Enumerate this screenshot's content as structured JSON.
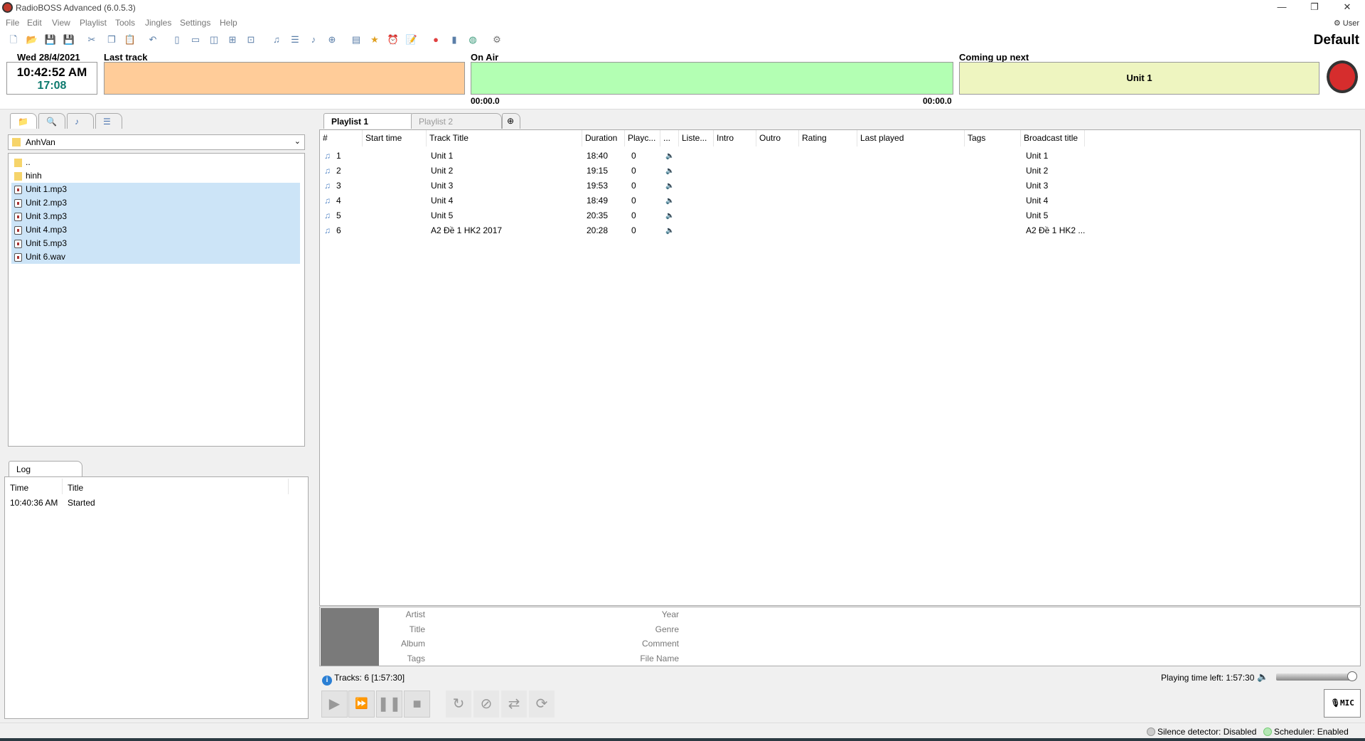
{
  "window": {
    "title": "RadioBOSS Advanced (6.0.5.3)",
    "user": "User",
    "profile": "Default"
  },
  "menu": [
    "File",
    "Edit",
    "View",
    "Playlist",
    "Tools",
    "Jingles",
    "Settings",
    "Help"
  ],
  "toolbar_icons": [
    "new-icon",
    "open-icon",
    "save-icon",
    "save-as-icon",
    "cut-icon",
    "copy-icon",
    "paste-icon",
    "undo-icon",
    "layout-left-icon",
    "layout-top-icon",
    "layout-two-icon",
    "layout-grid-icon",
    "layout-small-icon",
    "add-track-icon",
    "add-list-icon",
    "add-music-icon",
    "add-folder-icon",
    "report-icon",
    "jingle-icon",
    "scheduler-icon",
    "clipboard-icon",
    "record-icon",
    "stats-icon",
    "globe-icon",
    "settings-icon"
  ],
  "header": {
    "date": "Wed 28/4/2021",
    "time": "10:42:52 AM",
    "countdown": "17:08",
    "last_track_label": "Last track",
    "last_track": "",
    "on_air_label": "On Air",
    "on_air_elapsed": "00:00.0",
    "on_air_remaining": "00:00.0",
    "next_label": "Coming up next",
    "next_track": "Unit 1",
    "colors": {
      "last": "#ffcc99",
      "onair": "#b3ffb3",
      "next": "#eef5c0"
    }
  },
  "browser": {
    "folder": "AnhVan",
    "items": [
      {
        "name": "..",
        "type": "folder"
      },
      {
        "name": "hinh",
        "type": "folder"
      },
      {
        "name": "Unit 1.mp3",
        "type": "audio"
      },
      {
        "name": "Unit 2.mp3",
        "type": "audio"
      },
      {
        "name": "Unit 3.mp3",
        "type": "audio"
      },
      {
        "name": "Unit 4.mp3",
        "type": "audio"
      },
      {
        "name": "Unit 5.mp3",
        "type": "audio"
      },
      {
        "name": "Unit 6.wav",
        "type": "audio"
      }
    ]
  },
  "log": {
    "tab": "Log",
    "columns": [
      "Time",
      "Title"
    ],
    "rows": [
      [
        "10:40:36 AM",
        "Started"
      ]
    ]
  },
  "playlist": {
    "tabs": [
      "Playlist 1",
      "Playlist 2"
    ],
    "columns": [
      "#",
      "Start time",
      "Track Title",
      "Duration",
      "Playc...",
      "...",
      "Liste...",
      "Intro",
      "Outro",
      "Rating",
      "Last played",
      "Tags",
      "Broadcast title"
    ],
    "rows": [
      {
        "n": "1",
        "title": "Unit 1",
        "duration": "18:40",
        "playcount": "0",
        "broadcast": "Unit 1"
      },
      {
        "n": "2",
        "title": "Unit 2",
        "duration": "19:15",
        "playcount": "0",
        "broadcast": "Unit 2"
      },
      {
        "n": "3",
        "title": "Unit 3",
        "duration": "19:53",
        "playcount": "0",
        "broadcast": "Unit 3"
      },
      {
        "n": "4",
        "title": "Unit 4",
        "duration": "18:49",
        "playcount": "0",
        "broadcast": "Unit 4"
      },
      {
        "n": "5",
        "title": "Unit 5",
        "duration": "20:35",
        "playcount": "0",
        "broadcast": "Unit 5"
      },
      {
        "n": "6",
        "title": "A2 Đề 1 HK2 2017",
        "duration": "20:28",
        "playcount": "0",
        "broadcast": "A2 Đề 1 HK2 ..."
      }
    ]
  },
  "info": {
    "left": [
      "Artist",
      "Title",
      "Album",
      "Tags"
    ],
    "right": [
      "Year",
      "Genre",
      "Comment",
      "File Name"
    ]
  },
  "status": {
    "tracks": "Tracks: 6 [1:57:30]",
    "time_left": "Playing time left: 1:57:30",
    "volume_percent": 100,
    "mic": "MIC",
    "silence": "Silence detector: Disabled",
    "scheduler": "Scheduler: Enabled"
  }
}
